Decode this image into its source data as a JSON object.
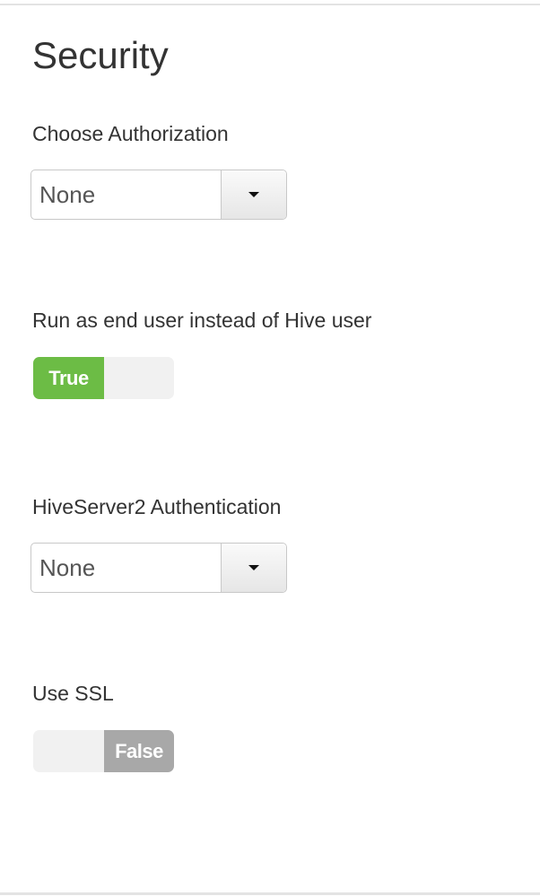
{
  "title": "Security",
  "authorization": {
    "label": "Choose Authorization",
    "value": "None"
  },
  "run_as_end_user": {
    "label": "Run as end user instead of Hive user",
    "state": "True",
    "on": true
  },
  "hs2_auth": {
    "label": "HiveServer2 Authentication",
    "value": "None"
  },
  "use_ssl": {
    "label": "Use SSL",
    "state": "False",
    "on": false
  },
  "colors": {
    "toggle_on": "#6cbc45",
    "toggle_off": "#a8a8a8"
  }
}
